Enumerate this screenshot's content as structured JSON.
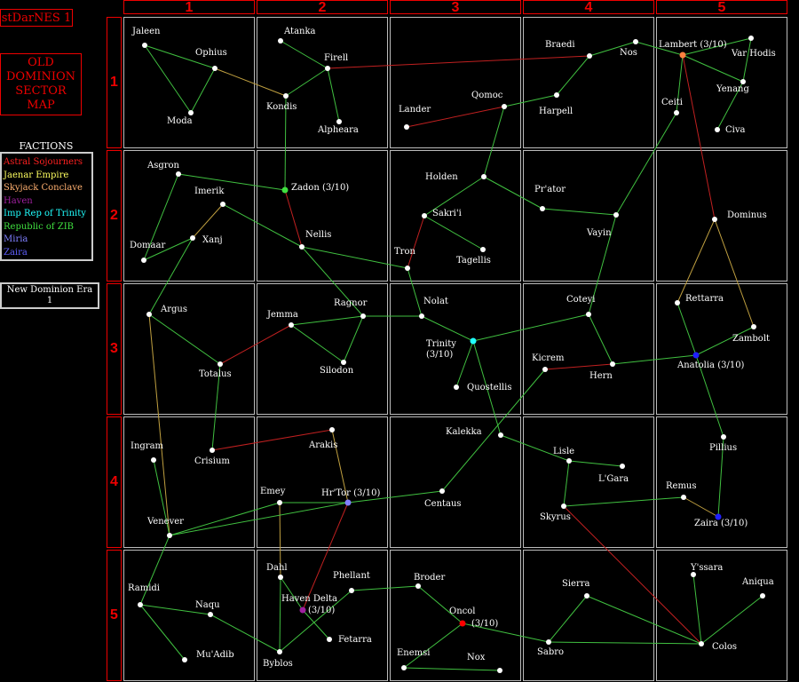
{
  "title": "stDarNES 1",
  "map_title": "OLD\nDOMINION\nSECTOR\nMAP",
  "factions_heading": "FACTIONS",
  "factions": [
    {
      "name": "Astral Sojourners",
      "color": "#ff2020"
    },
    {
      "name": "Jaenar Empire",
      "color": "#ffff60"
    },
    {
      "name": "Skyjack Conclave",
      "color": "#ffb070"
    },
    {
      "name": "Haven",
      "color": "#a020a0"
    },
    {
      "name": "Imp Rep of Trinity",
      "color": "#20ffff"
    },
    {
      "name": "Republic of ZIB",
      "color": "#40e040"
    },
    {
      "name": "Miria",
      "color": "#8080ff"
    },
    {
      "name": "Zaira",
      "color": "#6060ff"
    }
  ],
  "era": "New Dominion Era\n1",
  "columns": [
    "1",
    "2",
    "3",
    "4",
    "5"
  ],
  "rows": [
    "1",
    "2",
    "3",
    "4",
    "5"
  ],
  "systems": [
    {
      "id": "jaleen",
      "name": "Jaleen",
      "dot": "#ffffff"
    },
    {
      "id": "ophius",
      "name": "Ophius",
      "dot": "#ffffff"
    },
    {
      "id": "moda",
      "name": "Moda",
      "dot": "#ffffff"
    },
    {
      "id": "atanka",
      "name": "Atanka",
      "dot": "#ffffff"
    },
    {
      "id": "firell",
      "name": "Firell",
      "dot": "#ffffff"
    },
    {
      "id": "kondis",
      "name": "Kondis",
      "dot": "#ffffff"
    },
    {
      "id": "alpheara",
      "name": "Alpheara",
      "dot": "#ffffff"
    },
    {
      "id": "lander",
      "name": "Lander",
      "dot": "#ffffff"
    },
    {
      "id": "qomoc",
      "name": "Qomoc",
      "dot": "#ffffff"
    },
    {
      "id": "braedi",
      "name": "Braedi",
      "dot": "#ffffff"
    },
    {
      "id": "nos",
      "name": "Nos",
      "dot": "#ffffff"
    },
    {
      "id": "harpell",
      "name": "Harpell",
      "dot": "#ffffff"
    },
    {
      "id": "lambert",
      "name": "Lambert (3/10)",
      "dot": "#ff8040"
    },
    {
      "id": "varhodis",
      "name": "Var Hodis",
      "dot": "#ffffff"
    },
    {
      "id": "yenang",
      "name": "Yenang",
      "dot": "#ffffff"
    },
    {
      "id": "ceiti",
      "name": "Ceiti",
      "dot": "#ffffff"
    },
    {
      "id": "civa",
      "name": "Civa",
      "dot": "#ffffff"
    },
    {
      "id": "asgron",
      "name": "Asgron",
      "dot": "#ffffff"
    },
    {
      "id": "imerik",
      "name": "Imerik",
      "dot": "#ffffff"
    },
    {
      "id": "xanj",
      "name": "Xanj",
      "dot": "#ffffff"
    },
    {
      "id": "domaar",
      "name": "Domaar",
      "dot": "#ffffff"
    },
    {
      "id": "zadon",
      "name": "Zadon (3/10)",
      "dot": "#40e040"
    },
    {
      "id": "nellis",
      "name": "Nellis",
      "dot": "#ffffff"
    },
    {
      "id": "holden",
      "name": "Holden",
      "dot": "#ffffff"
    },
    {
      "id": "sakri",
      "name": "Sakri'i",
      "dot": "#ffffff"
    },
    {
      "id": "tagellis",
      "name": "Tagellis",
      "dot": "#ffffff"
    },
    {
      "id": "tron",
      "name": "Tron",
      "dot": "#ffffff"
    },
    {
      "id": "prator",
      "name": "Pr'ator",
      "dot": "#ffffff"
    },
    {
      "id": "vayin",
      "name": "Vayin",
      "dot": "#ffffff"
    },
    {
      "id": "dominus",
      "name": "Dominus",
      "dot": "#ffffff"
    },
    {
      "id": "argus",
      "name": "Argus",
      "dot": "#ffffff"
    },
    {
      "id": "totalus",
      "name": "Totalus",
      "dot": "#ffffff"
    },
    {
      "id": "jemma",
      "name": "Jemma",
      "dot": "#ffffff"
    },
    {
      "id": "ragnor",
      "name": "Ragnor",
      "dot": "#ffffff"
    },
    {
      "id": "silodon",
      "name": "Silodon",
      "dot": "#ffffff"
    },
    {
      "id": "nolat",
      "name": "Nolat",
      "dot": "#ffffff"
    },
    {
      "id": "trinity",
      "name": "Trinity",
      "sub": "(3/10)",
      "dot": "#20ffff"
    },
    {
      "id": "quostellis",
      "name": "Quostellis",
      "dot": "#ffffff"
    },
    {
      "id": "coteyi",
      "name": "Coteyi",
      "dot": "#ffffff"
    },
    {
      "id": "kicrem",
      "name": "Kicrem",
      "dot": "#ffffff"
    },
    {
      "id": "hern",
      "name": "Hern",
      "dot": "#ffffff"
    },
    {
      "id": "rettarra",
      "name": "Rettarra",
      "dot": "#ffffff"
    },
    {
      "id": "zambolt",
      "name": "Zambolt",
      "dot": "#ffffff"
    },
    {
      "id": "anatolia",
      "name": "Anatolia (3/10)",
      "dot": "#2020ff"
    },
    {
      "id": "ingram",
      "name": "Ingram",
      "dot": "#ffffff"
    },
    {
      "id": "crisium",
      "name": "Crisium",
      "dot": "#ffffff"
    },
    {
      "id": "arakis",
      "name": "Arakis",
      "dot": "#ffffff"
    },
    {
      "id": "emey",
      "name": "Emey",
      "dot": "#ffffff"
    },
    {
      "id": "hrtor",
      "name": "Hr'Tor (3/10)",
      "dot": "#8080ff"
    },
    {
      "id": "venever",
      "name": "Venever",
      "dot": "#ffffff"
    },
    {
      "id": "kalekka",
      "name": "Kalekka",
      "dot": "#ffffff"
    },
    {
      "id": "centaus",
      "name": "Centaus",
      "dot": "#ffffff"
    },
    {
      "id": "lisle",
      "name": "Lisle",
      "dot": "#ffffff"
    },
    {
      "id": "lgara",
      "name": "L'Gara",
      "dot": "#ffffff"
    },
    {
      "id": "skyrus",
      "name": "Skyrus",
      "dot": "#ffffff"
    },
    {
      "id": "remus",
      "name": "Remus",
      "dot": "#ffffff"
    },
    {
      "id": "pillius",
      "name": "Pillius",
      "dot": "#ffffff"
    },
    {
      "id": "zaira",
      "name": "Zaira (3/10)",
      "dot": "#2020ff"
    },
    {
      "id": "ramidi",
      "name": "Ramidi",
      "dot": "#ffffff"
    },
    {
      "id": "naqu",
      "name": "Naqu",
      "dot": "#ffffff"
    },
    {
      "id": "muadib",
      "name": "Mu'Adib",
      "dot": "#ffffff"
    },
    {
      "id": "dahl",
      "name": "Dahl",
      "dot": "#ffffff"
    },
    {
      "id": "havendelta",
      "name": "Haven Delta",
      "sub": "(3/10)",
      "dot": "#a020a0"
    },
    {
      "id": "byblos",
      "name": "Byblos",
      "dot": "#ffffff"
    },
    {
      "id": "phellant",
      "name": "Phellant",
      "dot": "#ffffff"
    },
    {
      "id": "fetarra",
      "name": "Fetarra",
      "dot": "#ffffff"
    },
    {
      "id": "broder",
      "name": "Broder",
      "dot": "#ffffff"
    },
    {
      "id": "oncol",
      "name": "Oncol",
      "sub": "(3/10)",
      "dot": "#ff0000"
    },
    {
      "id": "enemsi",
      "name": "Enemsi",
      "dot": "#ffffff"
    },
    {
      "id": "nox",
      "name": "Nox",
      "dot": "#ffffff"
    },
    {
      "id": "sierra",
      "name": "Sierra",
      "dot": "#ffffff"
    },
    {
      "id": "sabro",
      "name": "Sabro",
      "dot": "#ffffff"
    },
    {
      "id": "yssara",
      "name": "Y'ssara",
      "dot": "#ffffff"
    },
    {
      "id": "aniqua",
      "name": "Aniqua",
      "dot": "#ffffff"
    },
    {
      "id": "colos",
      "name": "Colos",
      "dot": "#ffffff"
    }
  ],
  "routes": [
    {
      "a": "jaleen",
      "b": "ophius",
      "c": "#40c040"
    },
    {
      "a": "jaleen",
      "b": "moda",
      "c": "#40c040"
    },
    {
      "a": "ophius",
      "b": "moda",
      "c": "#40c040"
    },
    {
      "a": "ophius",
      "b": "kondis",
      "c": "#c0a040"
    },
    {
      "a": "atanka",
      "b": "firell",
      "c": "#40c040"
    },
    {
      "a": "firell",
      "b": "kondis",
      "c": "#40c040"
    },
    {
      "a": "firell",
      "b": "alpheara",
      "c": "#40c040"
    },
    {
      "a": "firell",
      "b": "braedi",
      "c": "#c02020"
    },
    {
      "a": "kondis",
      "b": "zadon",
      "c": "#40c040"
    },
    {
      "a": "lander",
      "b": "qomoc",
      "c": "#c02020"
    },
    {
      "a": "qomoc",
      "b": "harpell",
      "c": "#40c040"
    },
    {
      "a": "qomoc",
      "b": "holden",
      "c": "#40c040"
    },
    {
      "a": "harpell",
      "b": "braedi",
      "c": "#40c040"
    },
    {
      "a": "braedi",
      "b": "nos",
      "c": "#40c040"
    },
    {
      "a": "nos",
      "b": "lambert",
      "c": "#40c040"
    },
    {
      "a": "lambert",
      "b": "varhodis",
      "c": "#40c040"
    },
    {
      "a": "lambert",
      "b": "yenang",
      "c": "#40c040"
    },
    {
      "a": "lambert",
      "b": "ceiti",
      "c": "#40c040"
    },
    {
      "a": "lambert",
      "b": "dominus",
      "c": "#c02020"
    },
    {
      "a": "varhodis",
      "b": "yenang",
      "c": "#40c040"
    },
    {
      "a": "yenang",
      "b": "civa",
      "c": "#40c040"
    },
    {
      "a": "ceiti",
      "b": "vayin",
      "c": "#40c040"
    },
    {
      "a": "asgron",
      "b": "zadon",
      "c": "#40c040"
    },
    {
      "a": "asgron",
      "b": "domaar",
      "c": "#40c040"
    },
    {
      "a": "domaar",
      "b": "xanj",
      "c": "#40c040"
    },
    {
      "a": "imerik",
      "b": "xanj",
      "c": "#c0a040"
    },
    {
      "a": "imerik",
      "b": "nellis",
      "c": "#40c040"
    },
    {
      "a": "xanj",
      "b": "argus",
      "c": "#40c040"
    },
    {
      "a": "zadon",
      "b": "nellis",
      "c": "#c02020"
    },
    {
      "a": "nellis",
      "b": "tron",
      "c": "#40c040"
    },
    {
      "a": "nellis",
      "b": "ragnor",
      "c": "#40c040"
    },
    {
      "a": "holden",
      "b": "sakri",
      "c": "#40c040"
    },
    {
      "a": "holden",
      "b": "prator",
      "c": "#40c040"
    },
    {
      "a": "sakri",
      "b": "tagellis",
      "c": "#40c040"
    },
    {
      "a": "sakri",
      "b": "tron",
      "c": "#c02020"
    },
    {
      "a": "tron",
      "b": "nolat",
      "c": "#40c040"
    },
    {
      "a": "prator",
      "b": "vayin",
      "c": "#40c040"
    },
    {
      "a": "vayin",
      "b": "coteyi",
      "c": "#40c040"
    },
    {
      "a": "dominus",
      "b": "rettarra",
      "c": "#c0a040"
    },
    {
      "a": "dominus",
      "b": "zambolt",
      "c": "#c0a040"
    },
    {
      "a": "argus",
      "b": "totalus",
      "c": "#40c040"
    },
    {
      "a": "argus",
      "b": "venever",
      "c": "#c0a040"
    },
    {
      "a": "totalus",
      "b": "jemma",
      "c": "#c02020"
    },
    {
      "a": "totalus",
      "b": "crisium",
      "c": "#40c040"
    },
    {
      "a": "jemma",
      "b": "ragnor",
      "c": "#40c040"
    },
    {
      "a": "jemma",
      "b": "silodon",
      "c": "#40c040"
    },
    {
      "a": "ragnor",
      "b": "silodon",
      "c": "#40c040"
    },
    {
      "a": "ragnor",
      "b": "nolat",
      "c": "#40c040"
    },
    {
      "a": "nolat",
      "b": "trinity",
      "c": "#40c040"
    },
    {
      "a": "trinity",
      "b": "quostellis",
      "c": "#40c040"
    },
    {
      "a": "trinity",
      "b": "coteyi",
      "c": "#40c040"
    },
    {
      "a": "trinity",
      "b": "kalekka",
      "c": "#40c040"
    },
    {
      "a": "coteyi",
      "b": "hern",
      "c": "#40c040"
    },
    {
      "a": "kicrem",
      "b": "hern",
      "c": "#c02020"
    },
    {
      "a": "kicrem",
      "b": "centaus",
      "c": "#40c040"
    },
    {
      "a": "hern",
      "b": "anatolia",
      "c": "#40c040"
    },
    {
      "a": "rettarra",
      "b": "anatolia",
      "c": "#40c040"
    },
    {
      "a": "zambolt",
      "b": "anatolia",
      "c": "#40c040"
    },
    {
      "a": "anatolia",
      "b": "pillius",
      "c": "#40c040"
    },
    {
      "a": "ingram",
      "b": "venever",
      "c": "#40c040"
    },
    {
      "a": "crisium",
      "b": "arakis",
      "c": "#c02020"
    },
    {
      "a": "arakis",
      "b": "hrtor",
      "c": "#c0a040"
    },
    {
      "a": "emey",
      "b": "hrtor",
      "c": "#40c040"
    },
    {
      "a": "emey",
      "b": "venever",
      "c": "#40c040"
    },
    {
      "a": "emey",
      "b": "dahl",
      "c": "#c0a040"
    },
    {
      "a": "hrtor",
      "b": "centaus",
      "c": "#40c040"
    },
    {
      "a": "hrtor",
      "b": "havendelta",
      "c": "#c02020"
    },
    {
      "a": "venever",
      "b": "hrtor",
      "c": "#40c040"
    },
    {
      "a": "venever",
      "b": "ramidi",
      "c": "#40c040"
    },
    {
      "a": "kalekka",
      "b": "lisle",
      "c": "#40c040"
    },
    {
      "a": "lisle",
      "b": "lgara",
      "c": "#40c040"
    },
    {
      "a": "lisle",
      "b": "skyrus",
      "c": "#40c040"
    },
    {
      "a": "skyrus",
      "b": "remus",
      "c": "#40c040"
    },
    {
      "a": "skyrus",
      "b": "colos",
      "c": "#c02020"
    },
    {
      "a": "remus",
      "b": "zaira",
      "c": "#c0a040"
    },
    {
      "a": "pillius",
      "b": "zaira",
      "c": "#40c040"
    },
    {
      "a": "ramidi",
      "b": "naqu",
      "c": "#40c040"
    },
    {
      "a": "ramidi",
      "b": "muadib",
      "c": "#40c040"
    },
    {
      "a": "naqu",
      "b": "byblos",
      "c": "#40c040"
    },
    {
      "a": "dahl",
      "b": "byblos",
      "c": "#40c040"
    },
    {
      "a": "dahl",
      "b": "havendelta",
      "c": "#40c040"
    },
    {
      "a": "havendelta",
      "b": "fetarra",
      "c": "#40c040"
    },
    {
      "a": "phellant",
      "b": "byblos",
      "c": "#40c040"
    },
    {
      "a": "phellant",
      "b": "broder",
      "c": "#40c040"
    },
    {
      "a": "broder",
      "b": "oncol",
      "c": "#40c040"
    },
    {
      "a": "oncol",
      "b": "enemsi",
      "c": "#40c040"
    },
    {
      "a": "oncol",
      "b": "sabro",
      "c": "#40c040"
    },
    {
      "a": "enemsi",
      "b": "nox",
      "c": "#40c040"
    },
    {
      "a": "sierra",
      "b": "sabro",
      "c": "#40c040"
    },
    {
      "a": "sierra",
      "b": "colos",
      "c": "#40c040"
    },
    {
      "a": "sabro",
      "b": "colos",
      "c": "#40c040"
    },
    {
      "a": "yssara",
      "b": "colos",
      "c": "#40c040"
    },
    {
      "a": "aniqua",
      "b": "colos",
      "c": "#40c040"
    }
  ]
}
